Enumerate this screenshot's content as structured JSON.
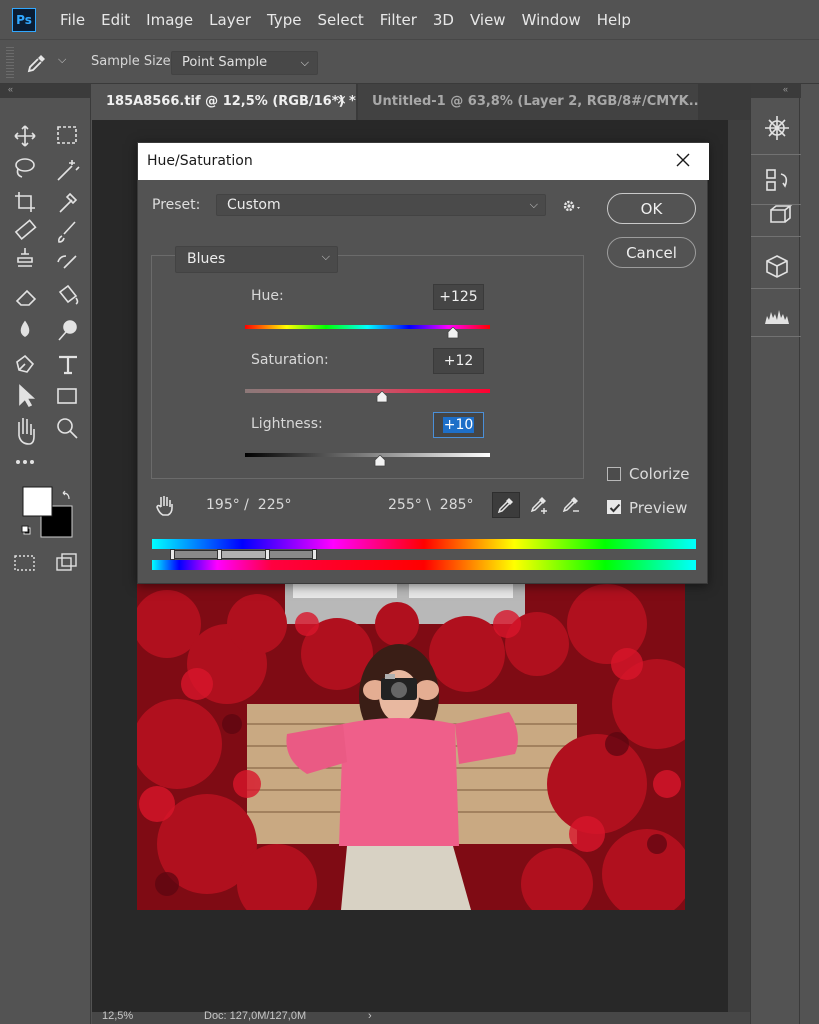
{
  "app": {
    "logo_text": "Ps"
  },
  "menu": [
    "File",
    "Edit",
    "Image",
    "Layer",
    "Type",
    "Select",
    "Filter",
    "3D",
    "View",
    "Window",
    "Help"
  ],
  "options": {
    "sample_size_label": "Sample Size:",
    "sample_size_value": "Point Sample"
  },
  "tabs": [
    {
      "label": "185A8566.tif @ 12,5% (RGB/16*) *",
      "close": "×"
    },
    {
      "label": "Untitled-1 @ 63,8% (Layer 2, RGB/8#/CMYK...",
      "close": "×"
    }
  ],
  "status": {
    "zoom": "12,5%",
    "doc": "Doc: 127,0M/127,0M"
  },
  "dialog": {
    "title": "Hue/Saturation",
    "preset_label": "Preset:",
    "preset_value": "Custom",
    "ok_label": "OK",
    "cancel_label": "Cancel",
    "channel": "Blues",
    "hue_label": "Hue:",
    "hue_value": "+125",
    "hue_fraction": 0.847,
    "saturation_label": "Saturation:",
    "saturation_value": "+12",
    "saturation_fraction": 0.56,
    "lightness_label": "Lightness:",
    "lightness_value": "+10",
    "lightness_fraction": 0.55,
    "colorize_label": "Colorize",
    "colorize_checked": false,
    "preview_label": "Preview",
    "preview_checked": true,
    "range_left": "195° /  225°",
    "range_right": "255° \\  285°"
  },
  "icons": {
    "left_tools": [
      "move-icon",
      "marquee-icon",
      "lasso-icon",
      "magic-wand-icon",
      "crop-icon",
      "eyedropper-icon",
      "healing-icon",
      "brush-icon",
      "stamp-icon",
      "history-brush-icon",
      "eraser-icon",
      "bucket-icon",
      "blur-icon",
      "dodge-icon",
      "pen-icon",
      "type-icon",
      "path-select-icon",
      "rectangle-icon",
      "hand-icon",
      "zoom-icon"
    ],
    "right_panel": [
      "navigator-icon",
      "history-icon",
      "3d-cube-icon",
      "cube-icon",
      "histogram-icon"
    ]
  },
  "colors": {
    "accent": "#31a8ff",
    "bg_dark": "#535353",
    "canvas": "#282828"
  }
}
